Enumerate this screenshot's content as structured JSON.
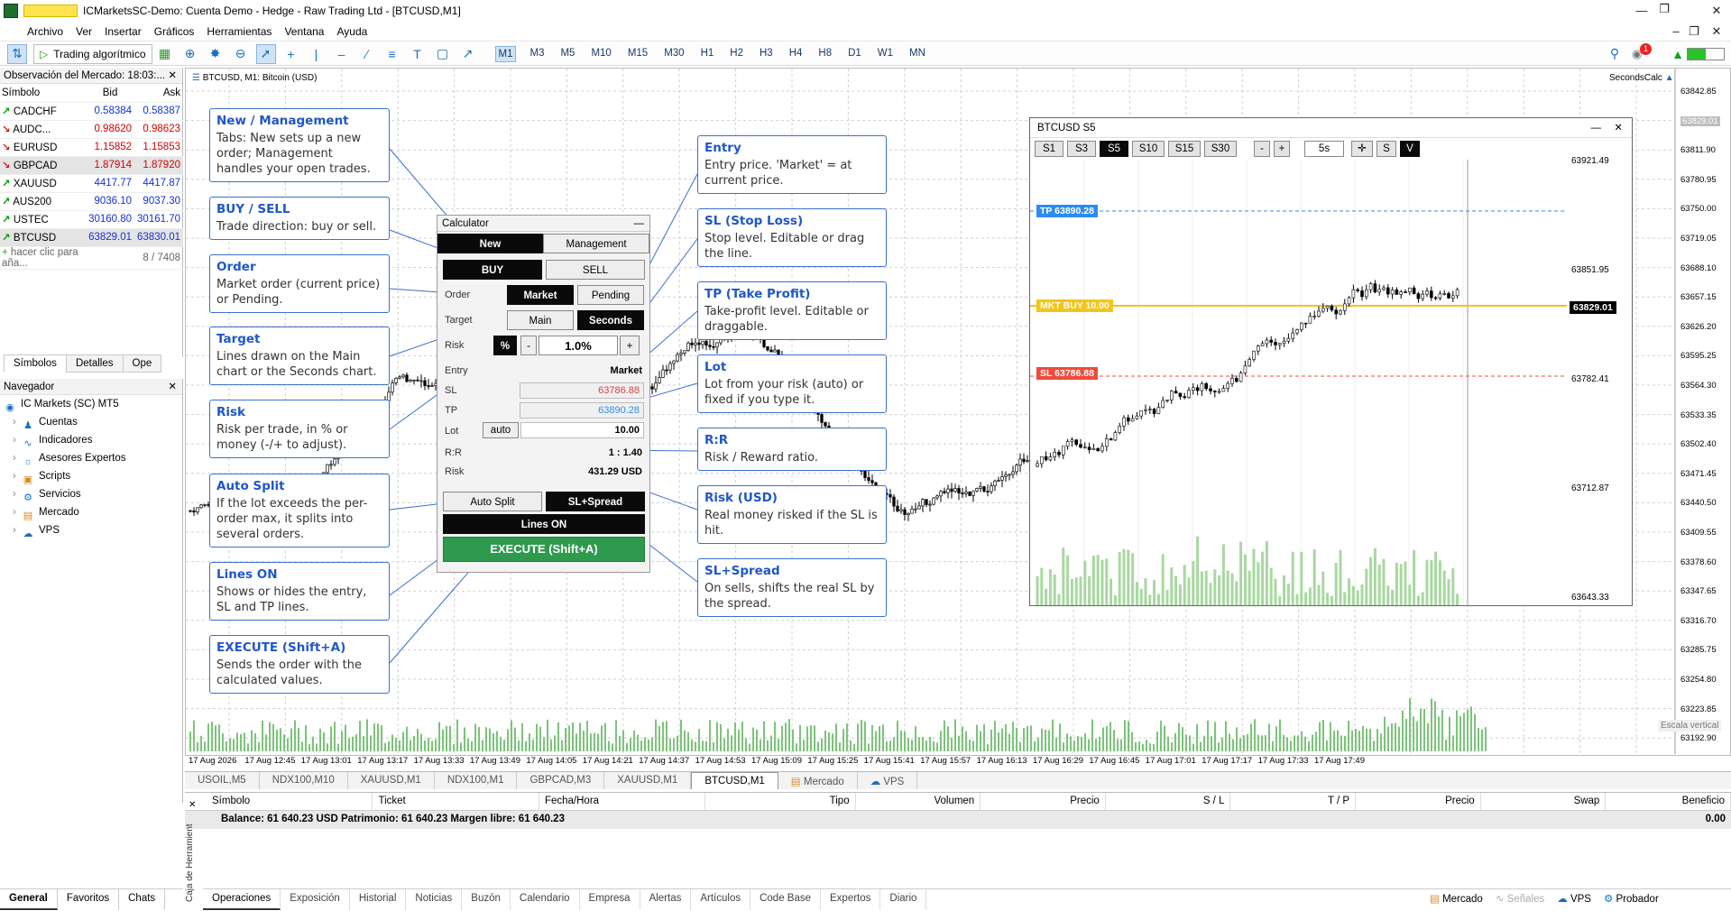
{
  "window": {
    "title": "ICMarketsSC-Demo: Cuenta Demo - Hedge - Raw Trading Ltd - [BTCUSD,M1]"
  },
  "menu": [
    "Archivo",
    "Ver",
    "Insertar",
    "Gráficos",
    "Herramientas",
    "Ventana",
    "Ayuda"
  ],
  "toolbar": {
    "algo_label": "Trading algorítmico",
    "timeframes": [
      "M1",
      "M3",
      "M5",
      "M10",
      "M15",
      "M30",
      "H1",
      "H2",
      "H3",
      "H4",
      "H8",
      "D1",
      "W1",
      "MN"
    ],
    "selected_tf": "M1",
    "notif_count": "1"
  },
  "market_watch": {
    "title": "Observación del Mercado: 18:03:...",
    "col_symbol": "Símbolo",
    "col_bid": "Bid",
    "col_ask": "Ask",
    "rows": [
      {
        "sym": "CADCHF",
        "bid": "0.58384",
        "ask": "0.58387",
        "dir": "up"
      },
      {
        "sym": "AUDC...",
        "bid": "0.98620",
        "ask": "0.98623",
        "dir": "dn"
      },
      {
        "sym": "EURUSD",
        "bid": "1.15852",
        "ask": "1.15853",
        "dir": "dn"
      },
      {
        "sym": "GBPCAD",
        "bid": "1.87914",
        "ask": "1.87920",
        "dir": "dn"
      },
      {
        "sym": "XAUUSD",
        "bid": "4417.77",
        "ask": "4417.87",
        "dir": "up"
      },
      {
        "sym": "AUS200",
        "bid": "9036.10",
        "ask": "9037.30",
        "dir": "up"
      },
      {
        "sym": "USTEC",
        "bid": "30160.80",
        "ask": "30161.70",
        "dir": "up"
      },
      {
        "sym": "BTCUSD",
        "bid": "63829.01",
        "ask": "63830.01",
        "dir": "up"
      }
    ],
    "add_hint": "hacer clic para aña...",
    "count": "8 / 7408",
    "tabs": [
      "Símbolos",
      "Detalles",
      "Ope"
    ]
  },
  "navigator": {
    "title": "Navegador",
    "items": [
      "IC Markets (SC) MT5",
      "Cuentas",
      "Indicadores",
      "Asesores Expertos",
      "Scripts",
      "Servicios",
      "Mercado",
      "VPS"
    ]
  },
  "left_tabs": [
    "General",
    "Favoritos",
    "Chats"
  ],
  "chart": {
    "caption": "BTCUSD, M1:  Bitcoin (USD)",
    "seconds_calc": "SecondsCalc",
    "price_labels": [
      "63842.85",
      "63829.01",
      "63811.90",
      "63780.95",
      "63750.00",
      "63719.05",
      "63688.10",
      "63657.15",
      "63626.20",
      "63595.25",
      "63564.30",
      "63533.35",
      "63502.40",
      "63471.45",
      "63440.50",
      "63409.55",
      "63378.60",
      "63347.65",
      "63316.70",
      "63285.75",
      "63254.80",
      "63223.85",
      "63192.90"
    ],
    "time_labels": [
      "17 Aug 2026",
      "17 Aug 12:45",
      "17 Aug 13:01",
      "17 Aug 13:17",
      "17 Aug 13:33",
      "17 Aug 13:49",
      "17 Aug 14:05",
      "17 Aug 14:21",
      "17 Aug 14:37",
      "17 Aug 14:53",
      "17 Aug 15:09",
      "17 Aug 15:25",
      "17 Aug 15:41",
      "17 Aug 15:57",
      "17 Aug 16:13",
      "17 Aug 16:29",
      "17 Aug 16:45",
      "17 Aug 17:01",
      "17 Aug 17:17",
      "17 Aug 17:33",
      "17 Aug 17:49"
    ],
    "scale_label": "Escala vertical"
  },
  "calculator": {
    "title": "Calculator",
    "tab_new": "New",
    "tab_mgmt": "Management",
    "buy": "BUY",
    "sell": "SELL",
    "order_label": "Order",
    "market": "Market",
    "pending": "Pending",
    "target_label": "Target",
    "main": "Main",
    "seconds": "Seconds",
    "risk_label": "Risk",
    "pct": "%",
    "minus": "-",
    "risk_value": "1.0%",
    "plus": "+",
    "entry_label": "Entry",
    "entry_value": "Market",
    "sl_label": "SL",
    "sl_value": "63786.88",
    "tp_label": "TP",
    "tp_value": "63890.28",
    "lot_label": "Lot",
    "auto": "auto",
    "lot_value": "10.00",
    "rr_label": "R:R",
    "rr_value": "1 : 1.40",
    "risk2_label": "Risk",
    "risk_usd": "431.29 USD",
    "auto_split": "Auto Split",
    "sl_spread": "SL+Spread",
    "lines_on": "Lines ON",
    "execute": "EXECUTE (Shift+A)"
  },
  "callouts_left": [
    {
      "title": "New / Management",
      "text": "Tabs: New sets up a new order; Management handles your open trades."
    },
    {
      "title": "BUY / SELL",
      "text": "Trade direction: buy or sell."
    },
    {
      "title": "Order",
      "text": "Market order (current price) or Pending."
    },
    {
      "title": "Target",
      "text": "Lines drawn on the Main chart or the Seconds chart."
    },
    {
      "title": "Risk",
      "text": "Risk per trade, in % or money (-/+ to adjust)."
    },
    {
      "title": "Auto Split",
      "text": "If the lot exceeds the per-order max, it splits into several orders."
    },
    {
      "title": "Lines ON",
      "text": "Shows or hides the entry, SL and TP lines."
    },
    {
      "title": "EXECUTE (Shift+A)",
      "text": "Sends the order with the calculated values."
    }
  ],
  "callouts_right": [
    {
      "title": "Entry",
      "text": "Entry price. 'Market' = at current price."
    },
    {
      "title": "SL (Stop Loss)",
      "text": "Stop level. Editable or drag the line."
    },
    {
      "title": "TP (Take Profit)",
      "text": "Take-profit level. Editable or draggable."
    },
    {
      "title": "Lot",
      "text": "Lot from your risk (auto) or fixed if you type it."
    },
    {
      "title": "R:R",
      "text": "Risk / Reward ratio."
    },
    {
      "title": "Risk (USD)",
      "text": "Real money risked if the SL is hit."
    },
    {
      "title": "SL+Spread",
      "text": "On sells, shifts the real SL by the spread."
    }
  ],
  "seconds_chart": {
    "title": "BTCUSD  S5",
    "buttons": [
      "S1",
      "S3",
      "S5",
      "S10",
      "S15",
      "S30",
      "-",
      "+",
      "5s",
      "✛",
      "S",
      "V"
    ],
    "tp_tag": "TP 63890.28",
    "sl_tag": "SL 63786.88",
    "mkt_tag": "MKT BUY 10.00",
    "price_tag": "63829.01",
    "price_labels": [
      "63921.49",
      "63851.95",
      "63782.41",
      "63712.87",
      "63643.33"
    ]
  },
  "symbol_tabs": [
    "USOIL,M5",
    "NDX100,M10",
    "XAUUSD,M1",
    "NDX100,M1",
    "GBPCAD,M3",
    "XAUUSD,M1",
    "BTCUSD,M1",
    "Mercado",
    "VPS"
  ],
  "terminal": {
    "columns": [
      "Símbolo",
      "Ticket",
      "Fecha/Hora",
      "Tipo",
      "Volumen",
      "Precio",
      "S / L",
      "T / P",
      "Precio",
      "Swap",
      "Beneficio"
    ],
    "balance": "Balance: 61 640.23 USD  Patrimonio: 61 640.23  Margen libre: 61 640.23",
    "profit": "0.00",
    "side_label": "Caja de Herramient",
    "tabs": [
      "Operaciones",
      "Exposición",
      "Historial",
      "Noticias",
      "Buzón",
      "Calendario",
      "Empresa",
      "Alertas",
      "Artículos",
      "Code Base",
      "Expertos",
      "Diario"
    ],
    "right": [
      "Mercado",
      "Señales",
      "VPS",
      "Probador"
    ]
  }
}
